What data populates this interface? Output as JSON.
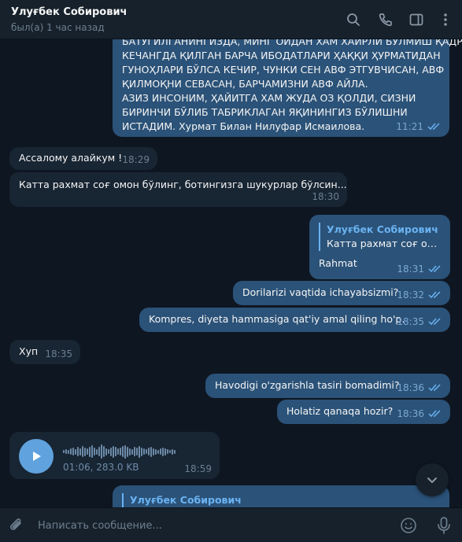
{
  "header": {
    "name": "Улуғбек Собирович",
    "status": "был(а) 1 час назад"
  },
  "messages": [
    {
      "direction": "out",
      "lines": [
        "БАТУГИЛГАНИНГИЗДА, МИНГ ОИДАН ХАМ ХАИРЛИ БУЛМИШ ҚАДР",
        "КЕЧАНГДА ҚИЛГАН БАРЧА ИБОДАТЛАРИ ҲАҚҚИ ҲУРМАТИДАН",
        "ГУНОҲЛАРИ БЎЛСА КЕЧИР, ЧУНКИ СЕН АВФ ЭТГУВЧИСАН, АВФ",
        "ҚИЛМОҚНИ СЕВАСАН, БАРЧАМИЗНИ АВФ АЙЛА.",
        "АЗИЗ ИНСОНИМ, ҲАЙИТГА ХАМ ЖУДА ОЗ ҚОЛДИ, СИЗНИ",
        "БИРИНЧИ БЎЛИБ ТАБРИКЛАГАН ЯҚИНИНГИЗ БЎЛИШНИ",
        "ИСТАДИМ. Хурмат Билан Нилуфар Исмаилова."
      ],
      "time": "11:21"
    },
    {
      "direction": "in",
      "text": "Ассалому алайкум !",
      "time": "18:29"
    },
    {
      "direction": "in",
      "text": "Катта рахмат соғ омон бўлинг,  ботингизга шукурлар бўлсин...",
      "time": "18:30"
    },
    {
      "direction": "out",
      "reply_name": "Улуғбек Собирович",
      "reply_text": "Катта рахмат соғ омон бўлинг,  ботингизга шукурлар бўлсин...",
      "text": "Rahmat",
      "time": "18:31"
    },
    {
      "direction": "out",
      "text": "Dorilarizi vaqtida ichayabsizmi?",
      "time": "18:32"
    },
    {
      "direction": "out",
      "text": "Kompres, diyeta hammasiga qat'iy amal qiling ho'p.",
      "time": "18:35"
    },
    {
      "direction": "in",
      "text": "Хуп",
      "time": "18:35"
    },
    {
      "direction": "out",
      "text": "Havodigi o'zgarishla tasiri bomadimi?",
      "time": "18:36"
    },
    {
      "direction": "out",
      "text": "Holatiz qanaqa hozir?",
      "time": "18:36"
    },
    {
      "direction": "in",
      "type": "voice",
      "duration_size": "01:06, 283.0 KB",
      "time": "18:59"
    },
    {
      "direction": "out",
      "reply_name": "Улуғбек Собирович"
    }
  ],
  "composer": {
    "placeholder": "Написать сообщение..."
  },
  "icons": {
    "search": "search-icon",
    "call": "phone-icon",
    "sidebar": "sidebar-toggle-icon",
    "menu": "more-vertical-icon",
    "attach": "paperclip-icon",
    "emoji": "emoji-icon",
    "mic": "microphone-icon",
    "scroll": "chevron-down-icon",
    "play": "play-icon",
    "read": "double-check-icon"
  },
  "colors": {
    "background": "#0e1621",
    "header": "#17212b",
    "incoming": "#182533",
    "outgoing": "#2b5278",
    "accent": "#6ab3f3"
  }
}
